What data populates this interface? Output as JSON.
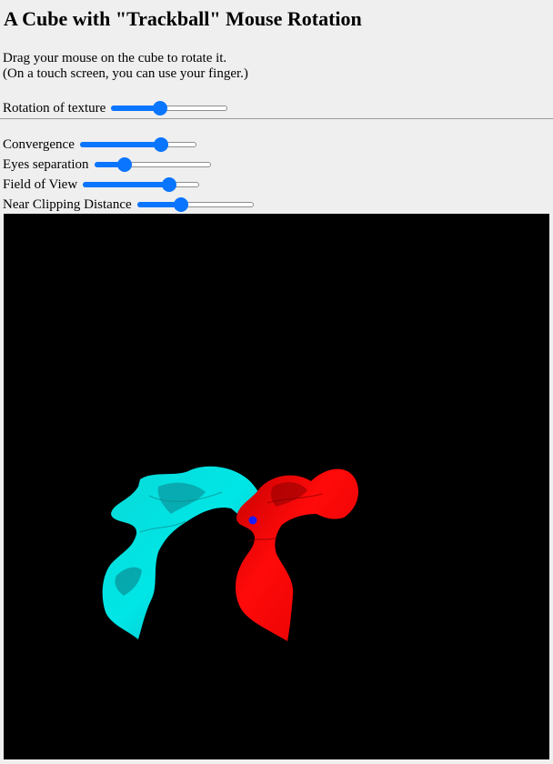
{
  "page": {
    "title": "A Cube with \"Trackball\" Mouse Rotation",
    "instructions_line1": "Drag your mouse on the cube to rotate it.",
    "instructions_line2": "(On a touch screen, you can use your finger.)"
  },
  "controls": {
    "rotation_of_texture": {
      "label": "Rotation of texture",
      "value_fraction": 0.42
    },
    "convergence": {
      "label": "Convergence",
      "value_fraction": 0.7
    },
    "eyes_separation": {
      "label": "Eyes separation",
      "value_fraction": 0.26
    },
    "field_of_view": {
      "label": "Field of View",
      "value_fraction": 0.74
    },
    "near_clipping_distance": {
      "label": "Near Clipping Distance",
      "value_fraction": 0.38
    }
  },
  "canvas": {
    "background": "#000000",
    "left_eye_color": "#00e0e0",
    "right_eye_color": "#ff0000",
    "marker_color": "#1a1aff"
  },
  "colors": {
    "accent": "#0a75ff",
    "page_background": "#efefef"
  }
}
